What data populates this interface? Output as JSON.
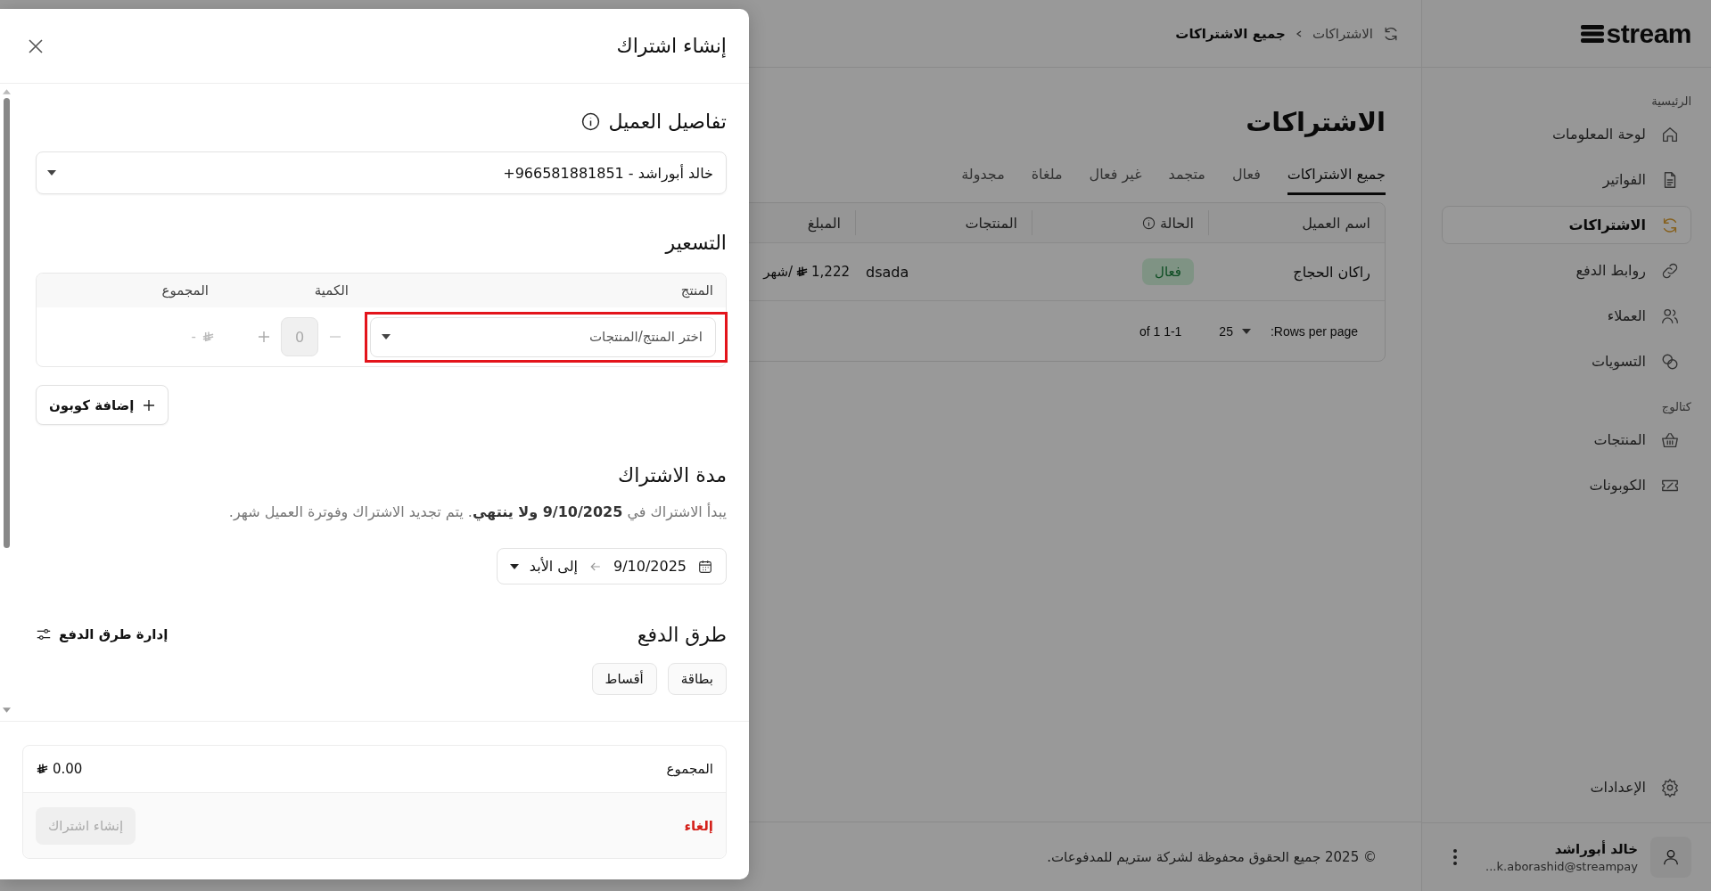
{
  "sidebar": {
    "logo": "stream",
    "sections": [
      {
        "label": "الرئيسية",
        "items": [
          {
            "label": "لوحة المعلومات",
            "selected": false
          },
          {
            "label": "الفواتير",
            "selected": false
          },
          {
            "label": "الاشتراكات",
            "selected": true
          },
          {
            "label": "روابط الدفع",
            "selected": false
          },
          {
            "label": "العملاء",
            "selected": false
          },
          {
            "label": "التسويات",
            "selected": false
          }
        ]
      },
      {
        "label": "كتالوج",
        "items": [
          {
            "label": "المنتجات",
            "selected": false
          },
          {
            "label": "الكوبونات",
            "selected": false
          }
        ]
      }
    ],
    "settings": "الإعدادات",
    "user": {
      "name": "خالد أبوراشد",
      "email": "k.aborashid@streampay..."
    }
  },
  "breadcrumb": [
    "الاشتراكات",
    "جميع الاشتراكات"
  ],
  "page_title": "الاشتراكات",
  "tabs": [
    {
      "label": "جميع الاشتراكات",
      "selected": true
    },
    {
      "label": "فعال",
      "selected": false
    },
    {
      "label": "متجمد",
      "selected": false
    },
    {
      "label": "غير فعال",
      "selected": false
    },
    {
      "label": "ملغاة",
      "selected": false
    },
    {
      "label": "مجدولة",
      "selected": false
    }
  ],
  "table": {
    "columns": [
      "اسم العميل",
      "الحالة",
      "المنتجات",
      "المبلغ"
    ],
    "rows": [
      {
        "customer": "راكان الحجاج",
        "status": "فعال",
        "products": "dsada",
        "amount": "1,222",
        "period": "/شهر"
      }
    ]
  },
  "pagination": {
    "label": "Rows per page:",
    "rows_per_page": "25",
    "range": "1-1 of 1"
  },
  "footer": "© 2025 جميع الحقوق محفوظة لشركة ستريم للمدفوعات.",
  "modal": {
    "title": "إنشاء اشتراك",
    "customer": {
      "heading": "تفاصيل العميل",
      "value": "خالد أبوراشد - 966581881851+"
    },
    "pricing": {
      "heading": "التسعير",
      "columns": [
        "المنتج",
        "الكمية",
        "المجموع"
      ],
      "product_placeholder": "اختر المنتج/المنتجات",
      "quantity": "0",
      "total": "-"
    },
    "coupon_button": "إضافة كوبون",
    "duration": {
      "heading": "مدة الاشتراك",
      "description": "يبدأ الاشتراك في **9/10/2025 ولا ينتهي**. يتم تجديد الاشتراك وفوترة العميل شهر.",
      "start": "9/10/2025",
      "end": "إلى الأبد"
    },
    "payment": {
      "heading": "طرق الدفع",
      "manage": "إدارة طرق الدفع",
      "methods": [
        "بطاقة",
        "أقساط"
      ]
    },
    "summary": {
      "label": "المجموع",
      "value": "0.00"
    },
    "cancel": "إلغاء",
    "submit": {
      "label": "إنشاء اشتراك",
      "disabled": true
    }
  }
}
